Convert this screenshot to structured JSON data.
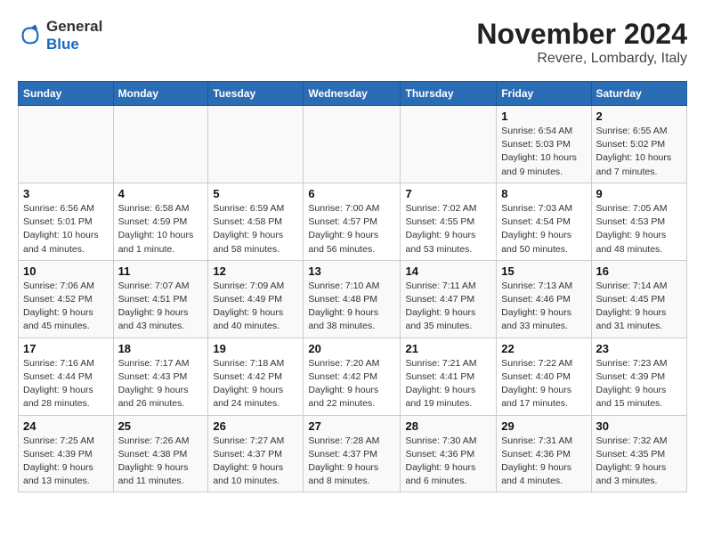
{
  "logo": {
    "line1": "General",
    "line2": "Blue"
  },
  "title": "November 2024",
  "subtitle": "Revere, Lombardy, Italy",
  "days_of_week": [
    "Sunday",
    "Monday",
    "Tuesday",
    "Wednesday",
    "Thursday",
    "Friday",
    "Saturday"
  ],
  "weeks": [
    [
      {
        "day": "",
        "info": ""
      },
      {
        "day": "",
        "info": ""
      },
      {
        "day": "",
        "info": ""
      },
      {
        "day": "",
        "info": ""
      },
      {
        "day": "",
        "info": ""
      },
      {
        "day": "1",
        "info": "Sunrise: 6:54 AM\nSunset: 5:03 PM\nDaylight: 10 hours and 9 minutes."
      },
      {
        "day": "2",
        "info": "Sunrise: 6:55 AM\nSunset: 5:02 PM\nDaylight: 10 hours and 7 minutes."
      }
    ],
    [
      {
        "day": "3",
        "info": "Sunrise: 6:56 AM\nSunset: 5:01 PM\nDaylight: 10 hours and 4 minutes."
      },
      {
        "day": "4",
        "info": "Sunrise: 6:58 AM\nSunset: 4:59 PM\nDaylight: 10 hours and 1 minute."
      },
      {
        "day": "5",
        "info": "Sunrise: 6:59 AM\nSunset: 4:58 PM\nDaylight: 9 hours and 58 minutes."
      },
      {
        "day": "6",
        "info": "Sunrise: 7:00 AM\nSunset: 4:57 PM\nDaylight: 9 hours and 56 minutes."
      },
      {
        "day": "7",
        "info": "Sunrise: 7:02 AM\nSunset: 4:55 PM\nDaylight: 9 hours and 53 minutes."
      },
      {
        "day": "8",
        "info": "Sunrise: 7:03 AM\nSunset: 4:54 PM\nDaylight: 9 hours and 50 minutes."
      },
      {
        "day": "9",
        "info": "Sunrise: 7:05 AM\nSunset: 4:53 PM\nDaylight: 9 hours and 48 minutes."
      }
    ],
    [
      {
        "day": "10",
        "info": "Sunrise: 7:06 AM\nSunset: 4:52 PM\nDaylight: 9 hours and 45 minutes."
      },
      {
        "day": "11",
        "info": "Sunrise: 7:07 AM\nSunset: 4:51 PM\nDaylight: 9 hours and 43 minutes."
      },
      {
        "day": "12",
        "info": "Sunrise: 7:09 AM\nSunset: 4:49 PM\nDaylight: 9 hours and 40 minutes."
      },
      {
        "day": "13",
        "info": "Sunrise: 7:10 AM\nSunset: 4:48 PM\nDaylight: 9 hours and 38 minutes."
      },
      {
        "day": "14",
        "info": "Sunrise: 7:11 AM\nSunset: 4:47 PM\nDaylight: 9 hours and 35 minutes."
      },
      {
        "day": "15",
        "info": "Sunrise: 7:13 AM\nSunset: 4:46 PM\nDaylight: 9 hours and 33 minutes."
      },
      {
        "day": "16",
        "info": "Sunrise: 7:14 AM\nSunset: 4:45 PM\nDaylight: 9 hours and 31 minutes."
      }
    ],
    [
      {
        "day": "17",
        "info": "Sunrise: 7:16 AM\nSunset: 4:44 PM\nDaylight: 9 hours and 28 minutes."
      },
      {
        "day": "18",
        "info": "Sunrise: 7:17 AM\nSunset: 4:43 PM\nDaylight: 9 hours and 26 minutes."
      },
      {
        "day": "19",
        "info": "Sunrise: 7:18 AM\nSunset: 4:42 PM\nDaylight: 9 hours and 24 minutes."
      },
      {
        "day": "20",
        "info": "Sunrise: 7:20 AM\nSunset: 4:42 PM\nDaylight: 9 hours and 22 minutes."
      },
      {
        "day": "21",
        "info": "Sunrise: 7:21 AM\nSunset: 4:41 PM\nDaylight: 9 hours and 19 minutes."
      },
      {
        "day": "22",
        "info": "Sunrise: 7:22 AM\nSunset: 4:40 PM\nDaylight: 9 hours and 17 minutes."
      },
      {
        "day": "23",
        "info": "Sunrise: 7:23 AM\nSunset: 4:39 PM\nDaylight: 9 hours and 15 minutes."
      }
    ],
    [
      {
        "day": "24",
        "info": "Sunrise: 7:25 AM\nSunset: 4:39 PM\nDaylight: 9 hours and 13 minutes."
      },
      {
        "day": "25",
        "info": "Sunrise: 7:26 AM\nSunset: 4:38 PM\nDaylight: 9 hours and 11 minutes."
      },
      {
        "day": "26",
        "info": "Sunrise: 7:27 AM\nSunset: 4:37 PM\nDaylight: 9 hours and 10 minutes."
      },
      {
        "day": "27",
        "info": "Sunrise: 7:28 AM\nSunset: 4:37 PM\nDaylight: 9 hours and 8 minutes."
      },
      {
        "day": "28",
        "info": "Sunrise: 7:30 AM\nSunset: 4:36 PM\nDaylight: 9 hours and 6 minutes."
      },
      {
        "day": "29",
        "info": "Sunrise: 7:31 AM\nSunset: 4:36 PM\nDaylight: 9 hours and 4 minutes."
      },
      {
        "day": "30",
        "info": "Sunrise: 7:32 AM\nSunset: 4:35 PM\nDaylight: 9 hours and 3 minutes."
      }
    ]
  ]
}
